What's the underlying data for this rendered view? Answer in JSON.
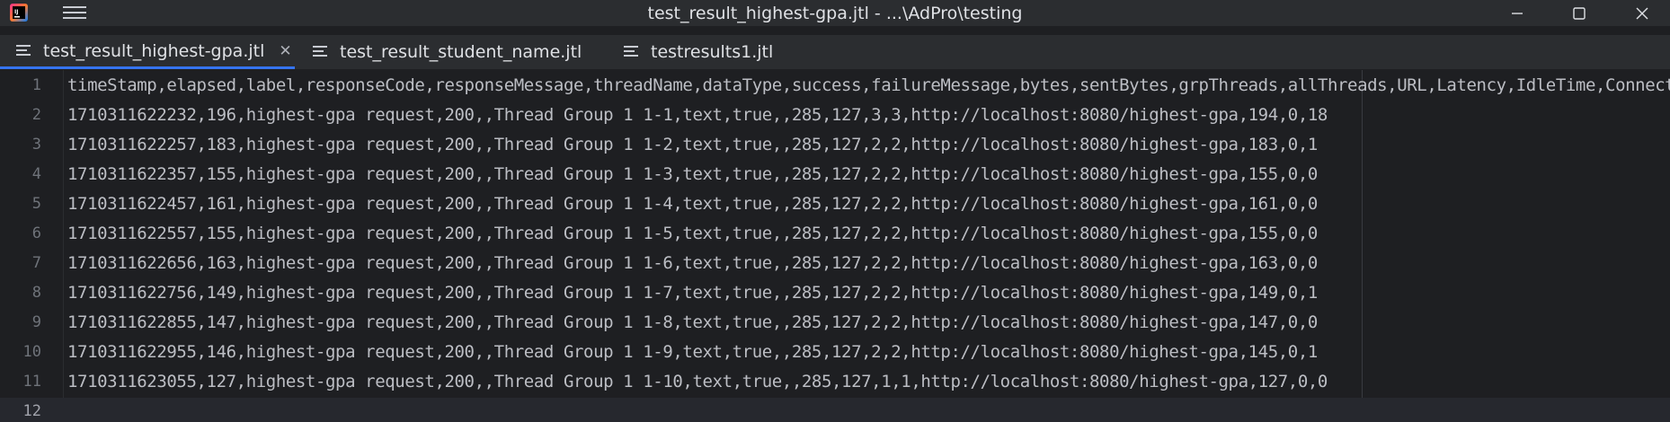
{
  "window": {
    "title": "test_result_highest-gpa.jtl - ...\\AdPro\\testing",
    "app_icon": "intellij-logo-icon",
    "menu_icon": "hamburger-menu-icon",
    "controls": {
      "minimize": "minimize-icon",
      "maximize": "maximize-icon",
      "close": "close-icon"
    }
  },
  "tabs": [
    {
      "label": "test_result_highest-gpa.jtl",
      "active": true,
      "closable": true
    },
    {
      "label": "test_result_student_name.jtl",
      "active": false,
      "closable": false
    },
    {
      "label": "testresults1.jtl",
      "active": false,
      "closable": false
    }
  ],
  "tab_close_glyph": "✕",
  "colors": {
    "accent": "#3574f0",
    "background": "#1e1f22",
    "chrome": "#2b2d30",
    "text": "#bcbec4",
    "line_numbers": "#6f737a"
  },
  "editor": {
    "lines": [
      {
        "number": "1",
        "text": "timeStamp,elapsed,label,responseCode,responseMessage,threadName,dataType,success,failureMessage,bytes,sentBytes,grpThreads,allThreads,URL,Latency,IdleTime,Connect"
      },
      {
        "number": "2",
        "text": "1710311622232,196,highest-gpa request,200,,Thread Group 1 1-1,text,true,,285,127,3,3,http://localhost:8080/highest-gpa,194,0,18"
      },
      {
        "number": "3",
        "text": "1710311622257,183,highest-gpa request,200,,Thread Group 1 1-2,text,true,,285,127,2,2,http://localhost:8080/highest-gpa,183,0,1"
      },
      {
        "number": "4",
        "text": "1710311622357,155,highest-gpa request,200,,Thread Group 1 1-3,text,true,,285,127,2,2,http://localhost:8080/highest-gpa,155,0,0"
      },
      {
        "number": "5",
        "text": "1710311622457,161,highest-gpa request,200,,Thread Group 1 1-4,text,true,,285,127,2,2,http://localhost:8080/highest-gpa,161,0,0"
      },
      {
        "number": "6",
        "text": "1710311622557,155,highest-gpa request,200,,Thread Group 1 1-5,text,true,,285,127,2,2,http://localhost:8080/highest-gpa,155,0,0"
      },
      {
        "number": "7",
        "text": "1710311622656,163,highest-gpa request,200,,Thread Group 1 1-6,text,true,,285,127,2,2,http://localhost:8080/highest-gpa,163,0,0"
      },
      {
        "number": "8",
        "text": "1710311622756,149,highest-gpa request,200,,Thread Group 1 1-7,text,true,,285,127,2,2,http://localhost:8080/highest-gpa,149,0,1"
      },
      {
        "number": "9",
        "text": "1710311622855,147,highest-gpa request,200,,Thread Group 1 1-8,text,true,,285,127,2,2,http://localhost:8080/highest-gpa,147,0,0"
      },
      {
        "number": "10",
        "text": "1710311622955,146,highest-gpa request,200,,Thread Group 1 1-9,text,true,,285,127,2,2,http://localhost:8080/highest-gpa,145,0,1"
      },
      {
        "number": "11",
        "text": "1710311623055,127,highest-gpa request,200,,Thread Group 1 1-10,text,true,,285,127,1,1,http://localhost:8080/highest-gpa,127,0,0"
      },
      {
        "number": "12",
        "text": ""
      }
    ]
  }
}
